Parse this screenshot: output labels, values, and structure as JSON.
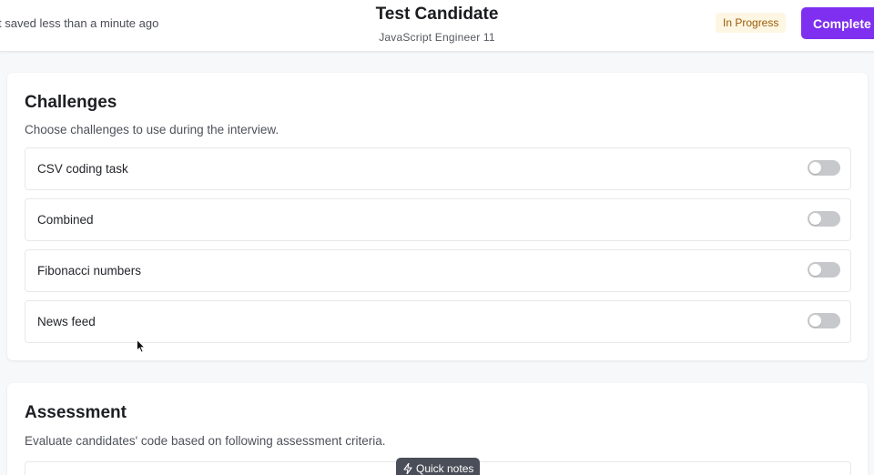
{
  "header": {
    "saved_status": "t saved less than a minute ago",
    "candidate_name": "Test Candidate",
    "candidate_role": "JavaScript Engineer 11",
    "status_badge": "In Progress",
    "complete_button": "Complete In"
  },
  "challenges": {
    "title": "Challenges",
    "description": "Choose challenges to use during the interview.",
    "items": [
      {
        "label": "CSV coding task",
        "enabled": false
      },
      {
        "label": "Combined",
        "enabled": false
      },
      {
        "label": "Fibonacci numbers",
        "enabled": false
      },
      {
        "label": "News feed",
        "enabled": false
      }
    ]
  },
  "assessment": {
    "title": "Assessment",
    "description": "Evaluate candidates' code based on following assessment criteria."
  },
  "quick_notes": {
    "label": "Quick notes",
    "icon": "bolt-icon"
  },
  "colors": {
    "accent": "#7e2ff0",
    "badge_bg": "#fdf6e3",
    "badge_text": "#9a5b06",
    "toggle_off": "#c7c8cb"
  }
}
